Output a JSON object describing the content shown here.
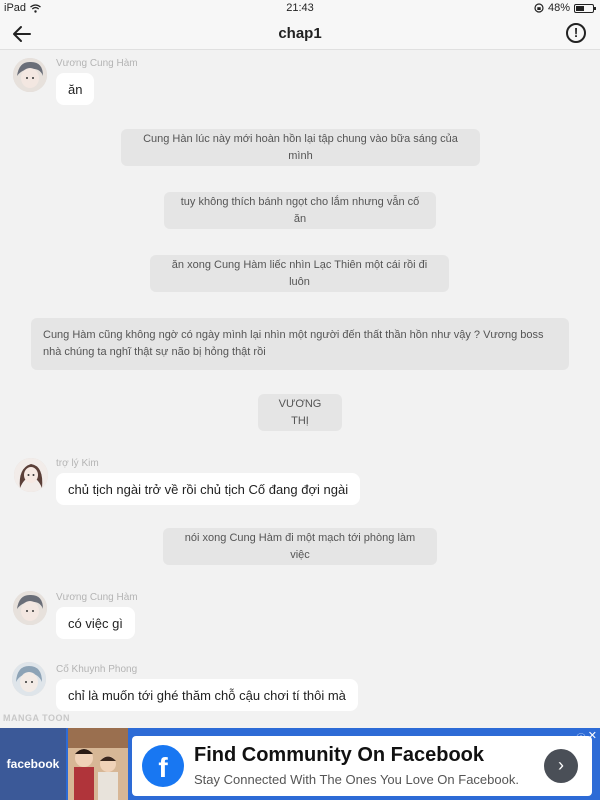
{
  "status_bar": {
    "device": "iPad",
    "time": "21:43",
    "battery": "48%"
  },
  "header": {
    "title": "chap1",
    "report_icon": "!"
  },
  "messages": [
    {
      "sender": "Vương Cung Hàm",
      "text": "ăn"
    },
    {
      "narration": "Cung Hàn lúc này mới hoàn hồn lại tập chung vào bữa sáng của mình"
    },
    {
      "narration": "tuy không thích bánh  ngọt cho lắm nhưng vẫn cố ăn"
    },
    {
      "narration": "ăn xong Cung Hàm liếc nhìn Lạc Thiên một cái rồi đi luôn"
    },
    {
      "narration": "Cung Hàm cũng không ngờ có ngày mình lại nhìn một người đến thất thần hồn như vậy ? Vương boss nhà chúng ta nghĩ thật sự não bị hỏng thật rồi"
    },
    {
      "narration": "VƯƠNG THỊ"
    },
    {
      "sender": "trợ lý Kim",
      "text": "chủ tịch ngài trở về rồi chủ tịch Cố đang đợi ngài"
    },
    {
      "narration": "nói xong Cung Hàm đi một mạch tới phòng làm việc"
    },
    {
      "sender": "Vương Cung Hàm",
      "text": "có việc gì"
    },
    {
      "sender": "Cố Khuynh Phong",
      "text": "chỉ là muốn tới ghé thăm chỗ cậu chơi tí thôi mà"
    }
  ],
  "watermark": "MANGA TOON",
  "ad": {
    "brand_logo": "facebook",
    "headline": "Find Community On Facebook",
    "subtext": "Stay Connected With The Ones You Love On Facebook.",
    "info_icon": "ⓘ",
    "close_icon": "✕"
  }
}
